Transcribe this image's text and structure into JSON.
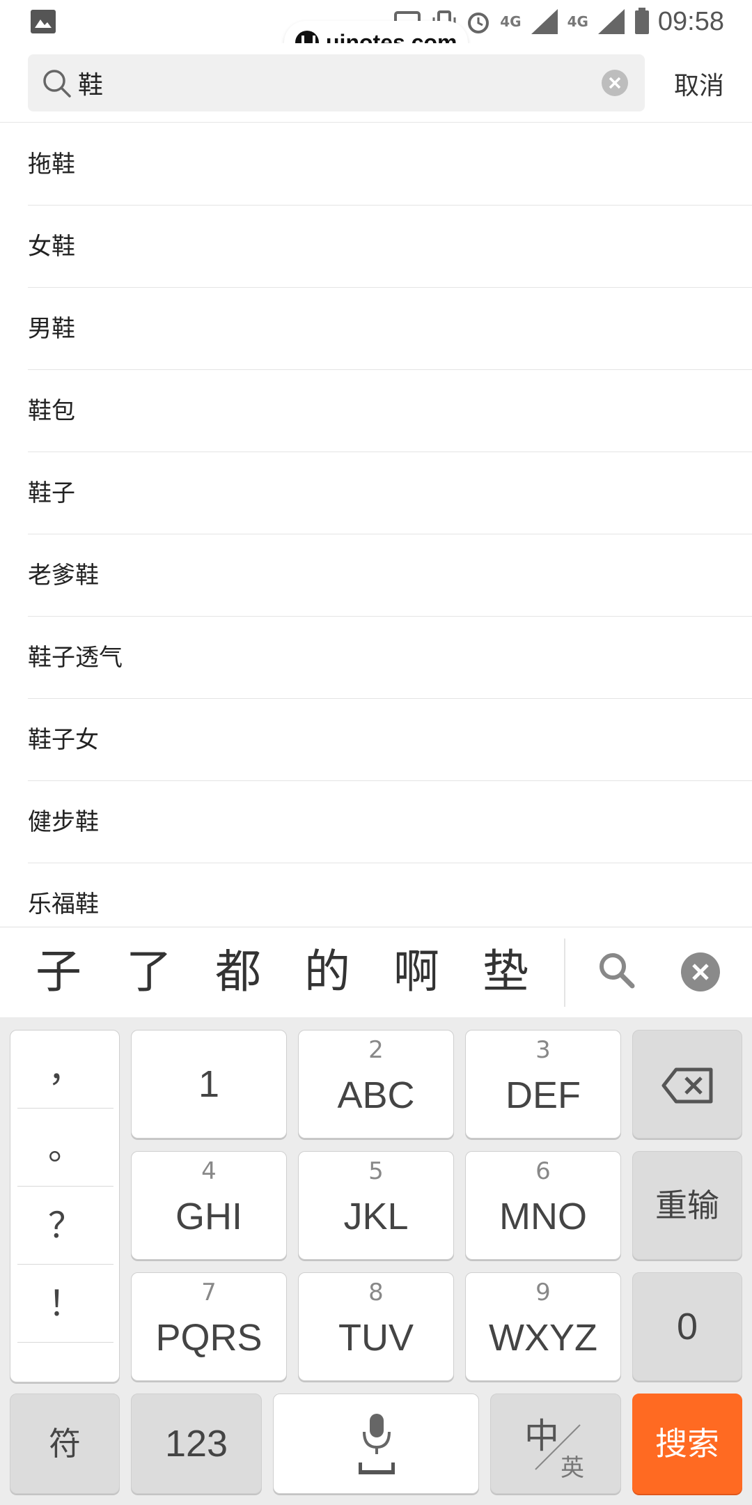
{
  "status_bar": {
    "time": "09:58",
    "network_1": "4G",
    "network_2": "4G",
    "icons": [
      "gallery-icon",
      "cast-icon",
      "vibrate-icon",
      "alarm-icon",
      "signal-icon",
      "battery-icon"
    ]
  },
  "watermark": {
    "text": "uinotes.com"
  },
  "search": {
    "query": "鞋",
    "cancel_label": "取消"
  },
  "suggestions": [
    "拖鞋",
    "女鞋",
    "男鞋",
    "鞋包",
    "鞋子",
    "老爹鞋",
    "鞋子透气",
    "鞋子女",
    "健步鞋",
    "乐福鞋"
  ],
  "candidates": [
    "子",
    "了",
    "都",
    "的",
    "啊",
    "垫"
  ],
  "keyboard": {
    "punctuation": [
      "，",
      "。",
      "？",
      "！"
    ],
    "keys": [
      {
        "num": "",
        "label": "1"
      },
      {
        "num": "2",
        "label": "ABC"
      },
      {
        "num": "3",
        "label": "DEF"
      },
      {
        "num": "4",
        "label": "GHI"
      },
      {
        "num": "5",
        "label": "JKL"
      },
      {
        "num": "6",
        "label": "MNO"
      },
      {
        "num": "7",
        "label": "PQRS"
      },
      {
        "num": "8",
        "label": "TUV"
      },
      {
        "num": "9",
        "label": "WXYZ"
      }
    ],
    "reinput_label": "重输",
    "zero_label": "0",
    "symbol_label": "符",
    "numbers_label": "123",
    "lang_zh": "中",
    "lang_en": "英",
    "search_label": "搜索"
  },
  "colors": {
    "accent": "#ff6a22",
    "background": "#ffffff",
    "keyboard_bg": "#ececec"
  }
}
